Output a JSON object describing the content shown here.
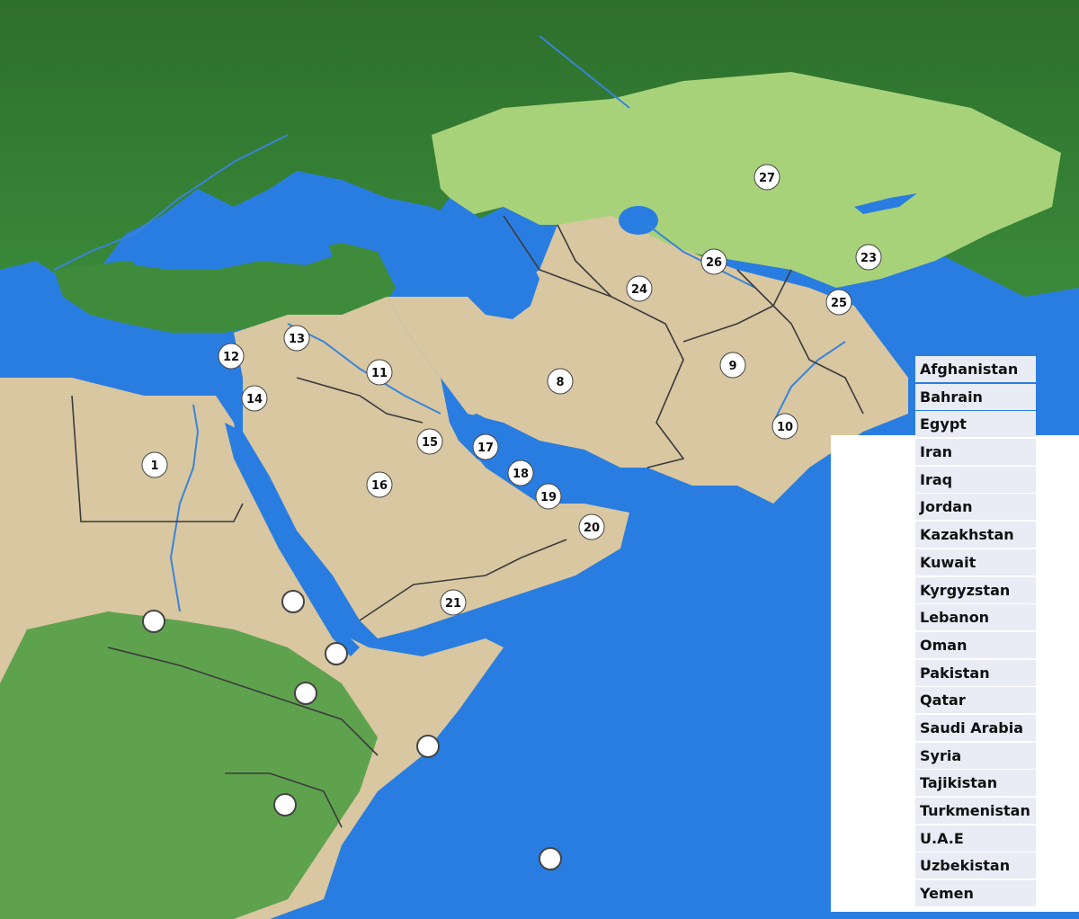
{
  "map": {
    "markers": [
      {
        "label": "1"
      },
      {
        "label": "8"
      },
      {
        "label": "9"
      },
      {
        "label": "10"
      },
      {
        "label": "11"
      },
      {
        "label": "12"
      },
      {
        "label": "13"
      },
      {
        "label": "14"
      },
      {
        "label": "15"
      },
      {
        "label": "16"
      },
      {
        "label": "17"
      },
      {
        "label": "18"
      },
      {
        "label": "19"
      },
      {
        "label": "20"
      },
      {
        "label": "21"
      },
      {
        "label": "23"
      },
      {
        "label": "24"
      },
      {
        "label": "25"
      },
      {
        "label": "26"
      },
      {
        "label": "27"
      },
      {
        "label": ""
      },
      {
        "label": ""
      },
      {
        "label": ""
      },
      {
        "label": ""
      },
      {
        "label": ""
      },
      {
        "label": ""
      },
      {
        "label": ""
      }
    ],
    "colors": {
      "sea": "#2a7de0",
      "forest": "#2f7d32",
      "steppe": "#a8d27a",
      "desert": "#d8c7a1",
      "border": "#3b3b3b",
      "river": "#3a84d8"
    }
  },
  "legend": {
    "items": [
      "Afghanistan",
      "Bahrain",
      "Egypt",
      "Iran",
      "Iraq",
      "Jordan",
      "Kazakhstan",
      "Kuwait",
      "Kyrgyzstan",
      "Lebanon",
      "Oman",
      "Pakistan",
      "Qatar",
      "Saudi Arabia",
      "Syria",
      "Tajikistan",
      "Turkmenistan",
      "U.A.E",
      "Uzbekistan",
      "Yemen"
    ]
  }
}
